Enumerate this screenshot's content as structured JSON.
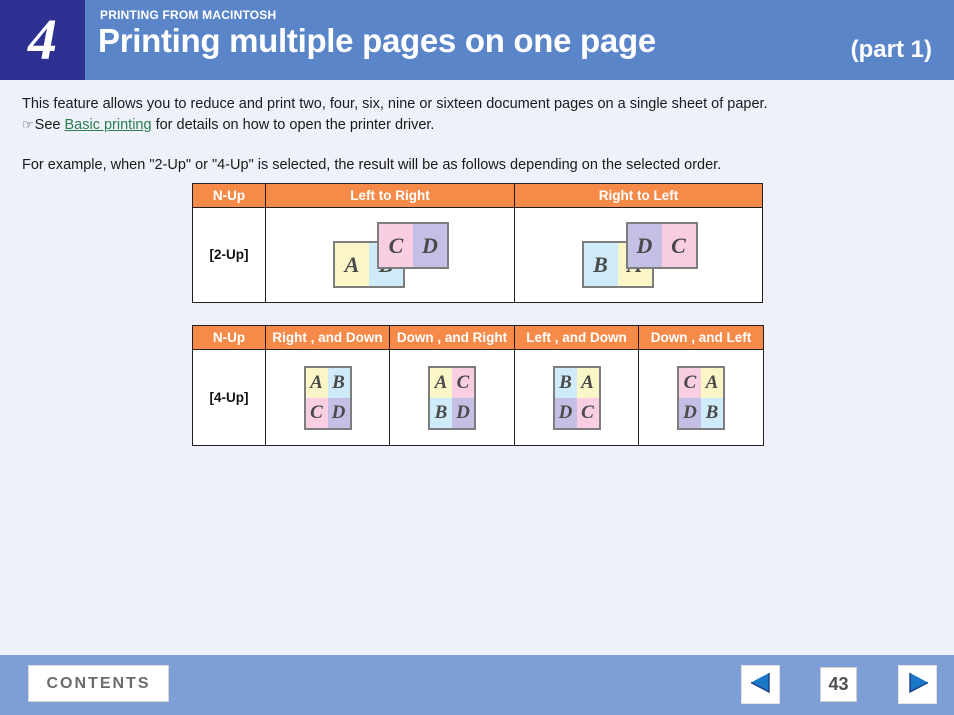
{
  "header": {
    "chapter_number": "4",
    "eyebrow": "PRINTING FROM MACINTOSH",
    "title": "Printing multiple pages on one page",
    "part_label": "(part 1)",
    "bg_color": "#5a85c9",
    "number_block_color": "#2e3192"
  },
  "body": {
    "intro_line1": "This feature allows you to reduce and print two, four, six, nine or sixteen document pages on a single sheet of paper.",
    "hand_icon": "hand-pointer-icon",
    "see_prefix": "See",
    "link_text": "Basic printing",
    "see_suffix": "for details on how to open the printer driver.",
    "link_color": "#2e7d4f",
    "example_line": "For example, when \"2-Up\" or \"4-Up\" is selected, the result will be as follows depending on the selected order."
  },
  "table_2up": {
    "header_bg": "#f58a49",
    "headers": [
      "N-Up",
      "Left to Right",
      "Right to Left"
    ],
    "row_label": "[2-Up]",
    "diagrams": [
      {
        "order": "Left to Right",
        "back_sheet": {
          "letters": [
            "A",
            "B"
          ],
          "colors": [
            "#fbf6c8",
            "#cfeaf8"
          ]
        },
        "front_sheet": {
          "letters": [
            "C",
            "D"
          ],
          "colors": [
            "#f9cde2",
            "#c4bfe4"
          ]
        }
      },
      {
        "order": "Right to Left",
        "back_sheet": {
          "letters": [
            "B",
            "A"
          ],
          "colors": [
            "#cfeaf8",
            "#fbf6c8"
          ]
        },
        "front_sheet": {
          "letters": [
            "D",
            "C"
          ],
          "colors": [
            "#c4bfe4",
            "#f9cde2"
          ]
        }
      }
    ]
  },
  "table_4up": {
    "header_bg": "#f58a49",
    "headers": [
      "N-Up",
      "Right , and Down",
      "Down , and Right",
      "Left , and Down",
      "Down , and Left"
    ],
    "row_label": "[4-Up]",
    "diagrams": [
      {
        "order": "Right , and Down",
        "letters": [
          "A",
          "B",
          "C",
          "D"
        ],
        "colors": [
          "#fbf6c8",
          "#cfeaf8",
          "#f9cde2",
          "#c4bfe4"
        ]
      },
      {
        "order": "Down , and Right",
        "letters": [
          "A",
          "C",
          "B",
          "D"
        ],
        "colors": [
          "#fbf6c8",
          "#f9cde2",
          "#cfeaf8",
          "#c4bfe4"
        ]
      },
      {
        "order": "Left , and Down",
        "letters": [
          "B",
          "A",
          "D",
          "C"
        ],
        "colors": [
          "#cfeaf8",
          "#fbf6c8",
          "#c4bfe4",
          "#f9cde2"
        ]
      },
      {
        "order": "Down , and Left",
        "letters": [
          "C",
          "A",
          "D",
          "B"
        ],
        "colors": [
          "#f9cde2",
          "#fbf6c8",
          "#c4bfe4",
          "#cfeaf8"
        ]
      }
    ]
  },
  "footer": {
    "bg_color": "#7e9fd6",
    "contents_label": "CONTENTS",
    "prev_icon": "triangle-left-icon",
    "next_icon": "triangle-right-icon",
    "page_number": "43",
    "nav_arrow_color": "#1b77c8"
  }
}
